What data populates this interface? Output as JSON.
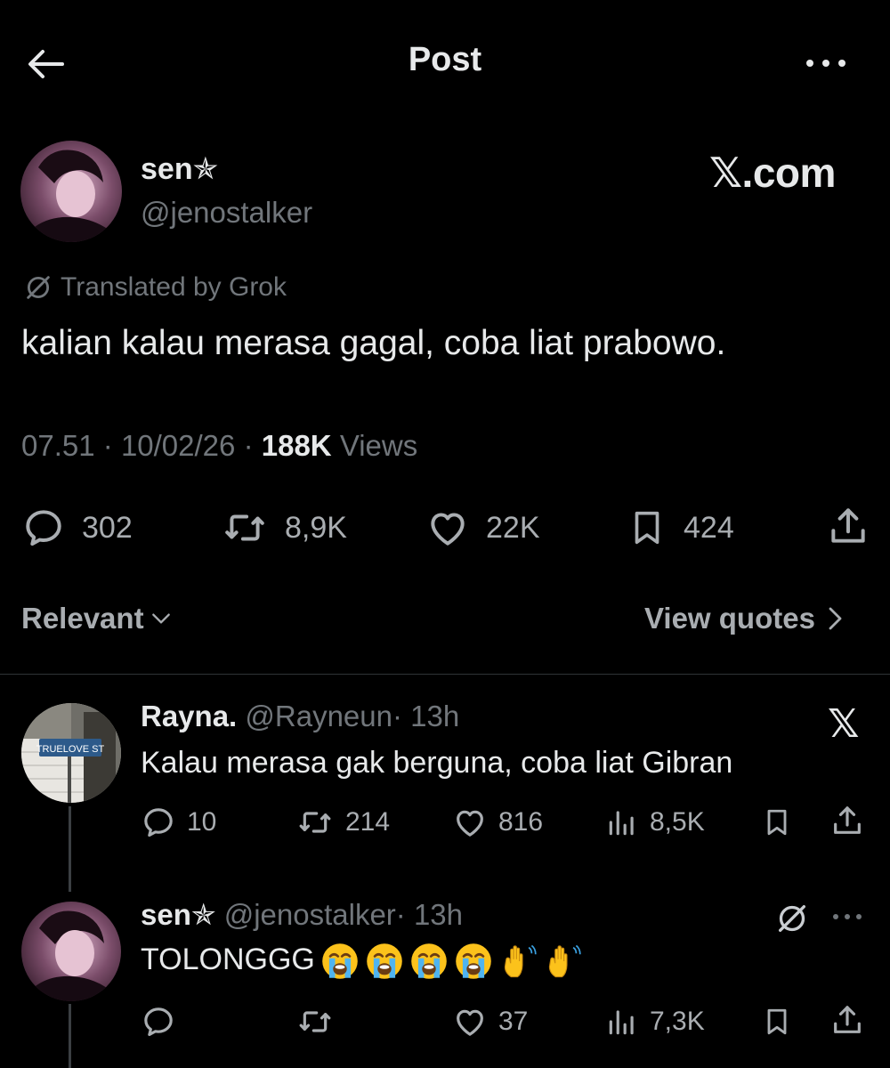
{
  "header": {
    "title": "Post",
    "back_icon": "back-arrow-icon",
    "more_icon": "more-horizontal-icon"
  },
  "post": {
    "name": "sen",
    "name_badge": "✯",
    "handle": "@jenostalker",
    "watermark": "𝕏.com",
    "translated_label": "Translated by Grok",
    "text": "kalian kalau merasa gagal, coba liat prabowo.",
    "time": "07.51",
    "date": "10/02/26",
    "separator": "·",
    "views_count": "188K",
    "views_label": "Views",
    "stats": {
      "replies": "302",
      "reposts": "8,9K",
      "likes": "22K",
      "bookmarks": "424"
    }
  },
  "filters": {
    "sort_label": "Relevant",
    "view_quotes_label": "View quotes"
  },
  "replies": [
    {
      "name": "Rayna.",
      "handle": "@Rayneun",
      "time": "· 13h",
      "text": "Kalau merasa gak berguna, coba liat Gibran",
      "badge_icon": "x-logo-icon",
      "avatar_sign": "TRUELOVE ST",
      "stats": {
        "replies": "10",
        "reposts": "214",
        "likes": "816",
        "views": "8,5K"
      }
    },
    {
      "name": "sen",
      "name_badge": "✯",
      "handle": "@jenostalker",
      "time": "· 13h",
      "text": "TOLONGGG",
      "emojis": [
        "loudly-crying-face",
        "loudly-crying-face",
        "loudly-crying-face",
        "loudly-crying-face",
        "waving-hand",
        "waving-hand"
      ],
      "badge_icon": "grok-icon",
      "stats": {
        "replies": "",
        "reposts": "",
        "likes": "37",
        "views": "7,3K"
      }
    }
  ],
  "colors": {
    "background": "#000000",
    "text": "#e7e9ea",
    "muted": "#71767b",
    "divider": "#2f3336"
  }
}
